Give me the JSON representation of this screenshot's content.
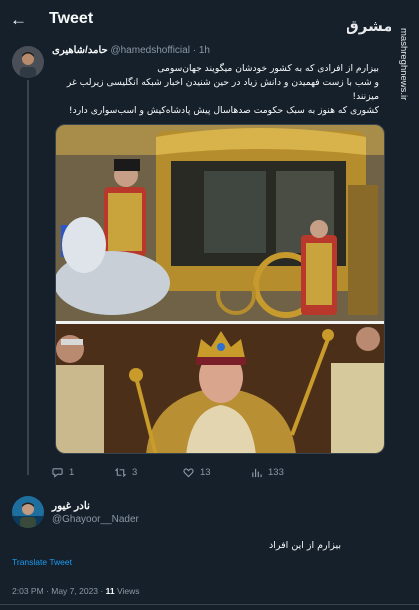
{
  "header": {
    "title": "Tweet"
  },
  "credit": "mashreghnews.ir",
  "logo_text": "مشرق",
  "tweet": {
    "author_name": "حامد/شاهیری",
    "handle": "@hamedshofficial",
    "separator": "·",
    "time": "1h",
    "text_lines": [
      "بیزارم از افرادی که به کشور خودشان میگویند جهان‌سومی",
      "و شب با زست فهمیدن و دانش زیاد در حین شنیدن اخبار شبکه انگلیسی زیرلب غر",
      "میزنند!",
      "کشوری که هنوز به سبک حکومت صدهاسال پیش پادشاه‌کیش و اسب‌سواری دارد!"
    ],
    "actions": {
      "replies": "1",
      "retweets": "3",
      "likes": "13",
      "views": "133"
    }
  },
  "reply": {
    "author_name": "نادر غیور",
    "handle": "@Ghayoor__Nader",
    "text": "بیزارم از این افراد",
    "translate_label": "Translate Tweet",
    "time": "2:03 PM",
    "date": "May 7, 2023",
    "views_count": "11",
    "views_label": "Views",
    "separator": "·"
  },
  "icons": {
    "back": "arrow-left-icon",
    "reply": "reply-icon",
    "retweet": "retweet-icon",
    "like": "heart-icon",
    "views": "views-icon"
  },
  "colors": {
    "background": "#15202b",
    "text": "#f7f9f9",
    "muted": "#8b98a5",
    "link": "#1d9bf0",
    "divider": "#38444d"
  }
}
